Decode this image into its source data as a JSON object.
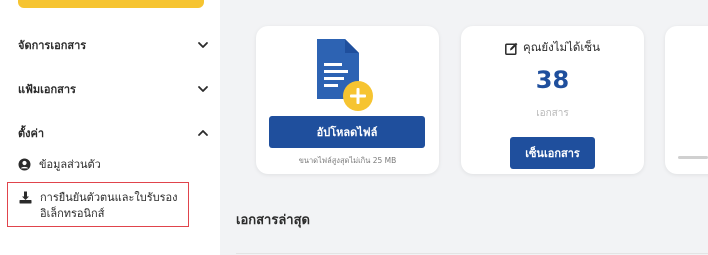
{
  "sidebar": {
    "menu": [
      {
        "label": "จัดการเอกสาร"
      },
      {
        "label": "แฟ้มเอกสาร"
      },
      {
        "label": "ตั้งค่า"
      }
    ],
    "settings_items": [
      {
        "label": "ข้อมูลส่วนตัว",
        "icon": "user-circle-icon"
      },
      {
        "label_line1": "การยืนยันตัวตนและใบรับรอง",
        "label_line2": "อิเล็กทรอนิกส์",
        "icon": "upload-tray-icon"
      }
    ]
  },
  "cards": {
    "upload": {
      "button_label": "อัปโหลดไฟล์",
      "note": "ขนาดไฟล์สูงสุดไม่เกิน 25 MB"
    },
    "unsigned": {
      "title": "คุณยังไม่ได้เซ็น",
      "count": "38",
      "unit": "เอกสาร",
      "button_label": "เซ็นเอกสาร"
    }
  },
  "recent": {
    "title": "เอกสารล่าสุด"
  },
  "colors": {
    "primary": "#1f4f9d",
    "accent_yellow": "#f6c431",
    "highlight_border": "#e0444c",
    "doc_blue": "#2d63b3"
  }
}
